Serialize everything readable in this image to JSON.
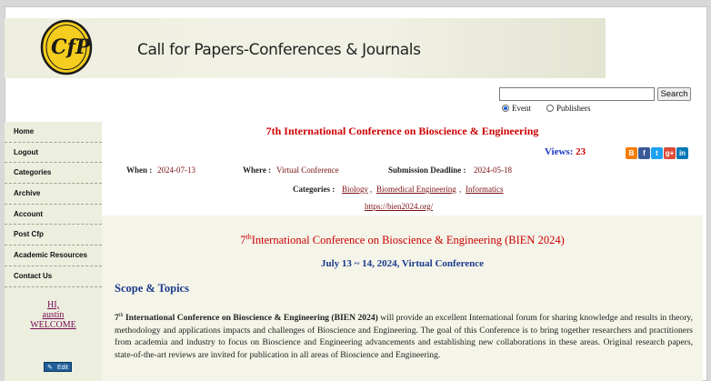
{
  "site": {
    "title": "Call for Papers-Conferences & Journals",
    "logo_text": "CfP"
  },
  "search": {
    "value": "",
    "placeholder": "",
    "button_label": "Search",
    "options": [
      "Event",
      "Publishers"
    ],
    "selected": "Event"
  },
  "nav": {
    "items": [
      "Home",
      "Logout",
      "Categories",
      "Archive",
      "Account",
      "Post Cfp",
      "Academic Resources",
      "Contact Us"
    ]
  },
  "user": {
    "greeting": "HI,",
    "name": "austin",
    "welcome": "WELCOME"
  },
  "edit": {
    "label": "Edit"
  },
  "event": {
    "title": "7th International Conference on Bioscience & Engineering",
    "views_label": "Views:",
    "views_count": "23",
    "when_label": "When :",
    "when": "2024-07-13",
    "where_label": "Where :",
    "where": "Virtual Conference",
    "deadline_label": "Submission Deadline :",
    "deadline": "2024-05-18",
    "categories_label": "Categories :",
    "categories": [
      "Biology",
      "Biomedical Engineering",
      "Informatics"
    ],
    "url": "https://bien2024.org/"
  },
  "share": [
    {
      "name": "blogger-icon",
      "color": "#f57d00",
      "glyph": "B"
    },
    {
      "name": "facebook-icon",
      "color": "#3b5998",
      "glyph": "f"
    },
    {
      "name": "twitter-icon",
      "color": "#1da1f2",
      "glyph": "t"
    },
    {
      "name": "google-plus-icon",
      "color": "#dd4b39",
      "glyph": "g+"
    },
    {
      "name": "linkedin-icon",
      "color": "#0077b5",
      "glyph": "in"
    }
  ],
  "body": {
    "heading_num": "7",
    "heading_sup": "th",
    "heading_rest": "International Conference on Bioscience & Engineering (BIEN 2024)",
    "dates": "July 13 ~ 14, 2024, Virtual Conference",
    "scope_title": "Scope & Topics",
    "para_num": "7",
    "para_sup": "th",
    "para_bold": " International Conference on Bioscience & Engineering (BIEN 2024)",
    "para_text": " will provide an excellent International forum for sharing knowledge and results in theory, methodology and applications impacts and challenges of Bioscience and Engineering. The goal of this Conference is to bring together researchers and practitioners from academia and industry to focus on Bioscience and Engineering advancements and establishing new collaborations in these areas. Original research papers, state-of-the-art reviews are invited for publication in all areas of Bioscience and Engineering."
  }
}
